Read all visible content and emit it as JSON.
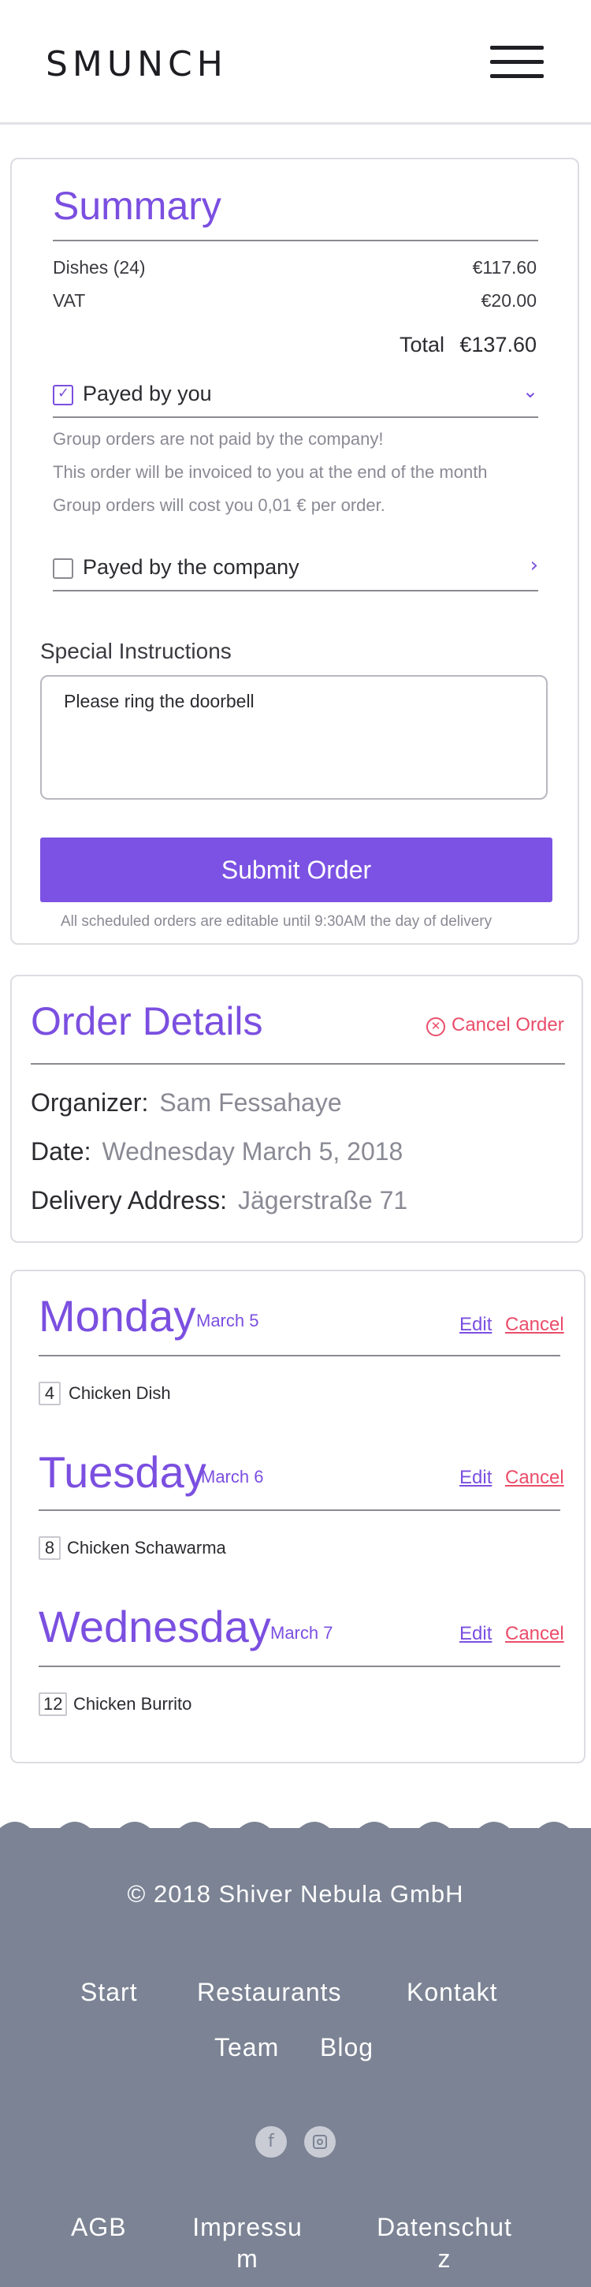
{
  "header": {
    "logo": "SMUNCH"
  },
  "summary": {
    "title": "Summary",
    "dishes_label": "Dishes (24)",
    "dishes_value": "€117.60",
    "vat_label": "VAT",
    "vat_value": "€20.00",
    "total_label": "Total",
    "total_value": "€137.60",
    "payment_options": [
      {
        "label": "Payed by you",
        "checked": true,
        "chevron": "chevron-down-icon"
      },
      {
        "label": "Payed by the company",
        "checked": false,
        "chevron": "chevron-right-icon"
      }
    ],
    "notes": [
      "Group orders are not paid by the company!",
      "This order will be invoiced to you at the end of the month",
      "Group orders will cost you 0,01 € per order."
    ],
    "special_instructions_label": "Special Instructions",
    "special_instructions_value": "Please ring the doorbell",
    "submit_label": "Submit Order",
    "editable_note": "All scheduled orders are editable until 9:30AM the day of delivery"
  },
  "order_details": {
    "title": "Order Details",
    "cancel_label": "Cancel Order",
    "organizer_key": "Organizer:",
    "organizer_value": "Sam Fessahaye",
    "date_key": "Date:",
    "date_value": "Wednesday March 5, 2018",
    "address_key": "Delivery Address:",
    "address_value": "Jägerstraße 71"
  },
  "days": [
    {
      "day": "Monday",
      "date": "March 5",
      "edit": "Edit",
      "cancel": "Cancel",
      "qty": "4",
      "dish": "Chicken Dish"
    },
    {
      "day": "Tuesday",
      "date": "March 6",
      "edit": "Edit",
      "cancel": "Cancel",
      "qty": "8",
      "dish": "Chicken Schawarma"
    },
    {
      "day": "Wednesday",
      "date": "March 7",
      "edit": "Edit",
      "cancel": "Cancel",
      "qty": "12",
      "dish": "Chicken Burrito"
    }
  ],
  "footer": {
    "copyright": "© 2018 Shiver Nebula GmbH",
    "nav": [
      "Start",
      "Restaurants",
      "Kontakt",
      "Team",
      "Blog"
    ],
    "social": [
      "facebook-icon",
      "instagram-icon"
    ],
    "social_glyph_facebook": "f",
    "legal": [
      "AGB",
      "Impressum",
      "Datenschutz"
    ],
    "legal_lines": [
      [
        "AGB"
      ],
      [
        "Impressu",
        "m"
      ],
      [
        "Datenschut",
        "z"
      ]
    ]
  },
  "colors": {
    "accent": "#7b52e3",
    "danger": "#ea4d6a",
    "footer_bg": "#7b8394",
    "muted_text": "#8a8a95"
  }
}
